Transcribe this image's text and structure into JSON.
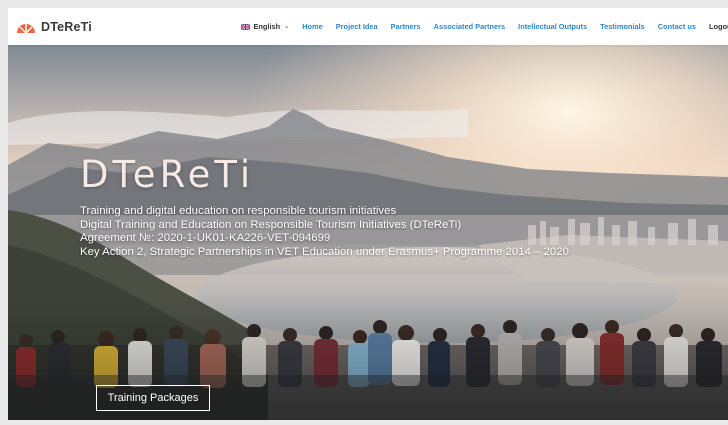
{
  "brand": {
    "name": "DTeReTi",
    "logo_icon": "sunrise-logo-icon",
    "accent": "#e8654a"
  },
  "nav": {
    "language": {
      "label": "English",
      "icon": "uk-flag-icon"
    },
    "items": [
      "Home",
      "Project Idea",
      "Partners",
      "Associated Partners",
      "Intellectual Outputs",
      "Testimonials",
      "Contact us"
    ],
    "logout": "Logout",
    "link_color": "#2f86c9"
  },
  "hero": {
    "title": "DTeReTi",
    "lines": [
      "Training and digital education on responsible tourism initiatives",
      "Digital Training and Education on Responsible Tourism Initiatives (DTeReTi)",
      "Agreement №: 2020-1-UK01-KA226-VET-094699",
      "Key Action 2, Strategic Partnerships in VET Education under Erasmus+ Programme 2014 – 2020"
    ],
    "cta_label": "Training Packages"
  }
}
